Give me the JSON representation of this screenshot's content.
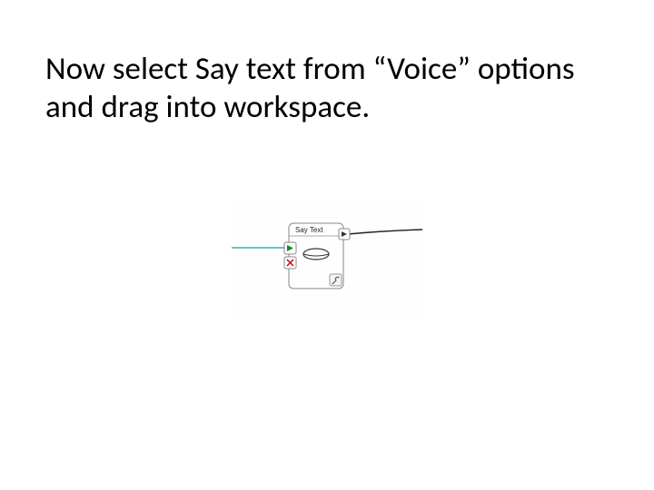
{
  "heading": "Now select Say text from “Voice” options and drag into workspace.",
  "node": {
    "title": "Say Text"
  }
}
